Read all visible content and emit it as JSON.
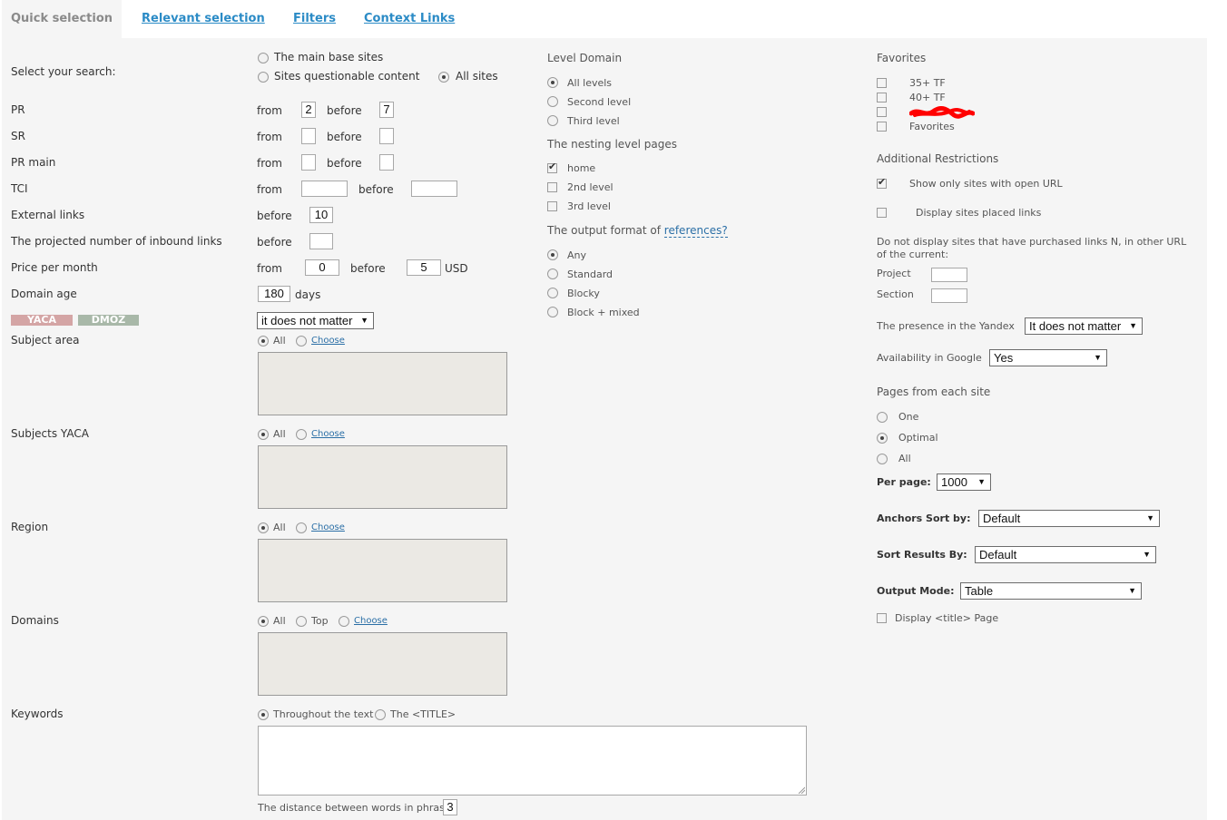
{
  "tabs": [
    "Quick selection",
    "Relevant selection",
    "Filters",
    "Context Links"
  ],
  "left": {
    "select_search": {
      "label": "Select your search:",
      "options": [
        "The main base sites",
        "Sites questionable content",
        "All sites"
      ]
    },
    "pr": {
      "label": "PR",
      "from": "from",
      "before": "before",
      "from_value": "2",
      "before_value": "7"
    },
    "sr": {
      "label": "SR",
      "from": "from",
      "before": "before"
    },
    "pr_main": {
      "label": "PR main",
      "from": "from",
      "before": "before"
    },
    "tci": {
      "label": "TCI",
      "from": "from",
      "before": "before"
    },
    "external_links": {
      "label": "External links",
      "before": "before",
      "value": "10"
    },
    "inbound": {
      "label": "The projected number of inbound links",
      "before": "before"
    },
    "price": {
      "label": "Price per month",
      "from": "from",
      "before": "before",
      "from_value": "0",
      "before_value": "5",
      "currency": "USD"
    },
    "domain_age": {
      "label": "Domain age",
      "value": "180",
      "unit": "days"
    },
    "badges": {
      "yaca": "YACA",
      "dmoz": "DMOZ"
    },
    "catalog_select": "it does not matter",
    "subject_area": {
      "label": "Subject area",
      "all": "All",
      "choose": "Choose"
    },
    "subjects_yaca": {
      "label": "Subjects YACA",
      "all": "All",
      "choose": "Choose"
    },
    "region": {
      "label": "Region",
      "all": "All",
      "choose": "Choose"
    },
    "domains": {
      "label": "Domains",
      "all": "All",
      "top": "Top",
      "choose": "Choose"
    },
    "keywords": {
      "label": "Keywords",
      "opt1": "Throughout the text",
      "opt2": "The <TITLE>"
    },
    "distance": {
      "label": "The distance between words in phrases",
      "value": "3"
    }
  },
  "middle": {
    "level_domain": {
      "title": "Level Domain",
      "options": [
        "All levels",
        "Second level",
        "Third level"
      ]
    },
    "nesting": {
      "title": "The nesting level pages",
      "options": [
        "home",
        "2nd level",
        "3rd level"
      ]
    },
    "output_format": {
      "title": "The output format of",
      "link": "references?",
      "options": [
        "Any",
        "Standard",
        "Blocky",
        "Block + mixed"
      ]
    }
  },
  "right": {
    "favorites": {
      "title": "Favorites",
      "items": [
        "35+ TF",
        "40+ TF",
        "",
        "Favorites"
      ]
    },
    "restrictions": {
      "title": "Additional Restrictions",
      "open_url": "Show only sites with open URL",
      "placed_links": "Display sites placed links",
      "not_display_1": "Do not display sites that have purchased links N, in other URL",
      "not_display_2": "of the current:",
      "project": "Project",
      "section": "Section"
    },
    "yandex": {
      "label": "The presence in the Yandex",
      "value": "It does not matter"
    },
    "google": {
      "label": "Availability in Google",
      "value": "Yes"
    },
    "pages": {
      "title": "Pages from each site",
      "options": [
        "One",
        "Optimal",
        "All"
      ]
    },
    "per_page": {
      "label": "Per page:",
      "value": "1000"
    },
    "anchors_sort": {
      "label": "Anchors Sort by:",
      "value": "Default"
    },
    "sort_results": {
      "label": "Sort Results By:",
      "value": "Default"
    },
    "output_mode": {
      "label": "Output Mode:",
      "value": "Table"
    },
    "display_title": "Display <title> Page"
  },
  "colors": {
    "accent": "#2b8bc6",
    "panel": "#f5f5f5",
    "yaca": "#d4a5a5",
    "dmoz": "#a8b8a8"
  }
}
